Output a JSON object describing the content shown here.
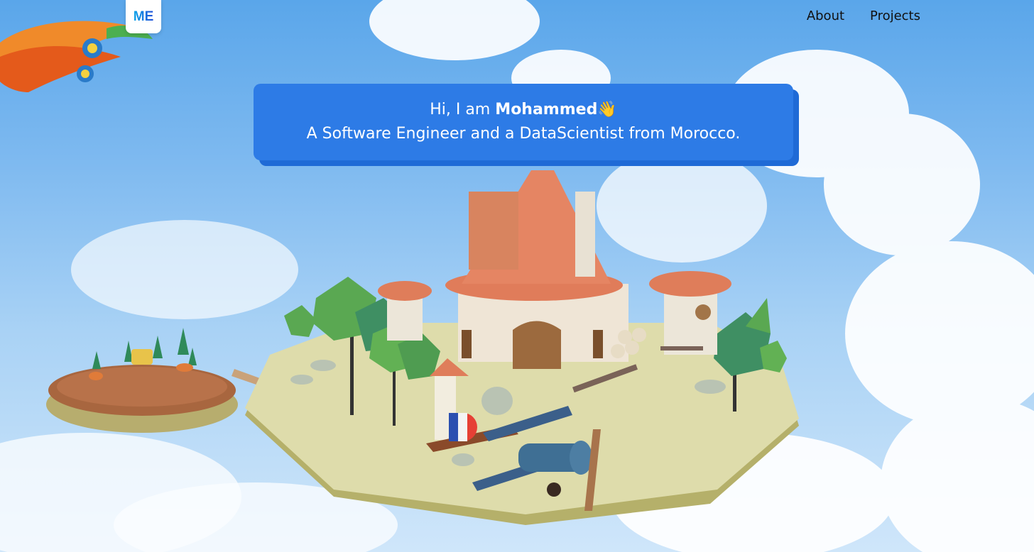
{
  "header": {
    "logo_text": "ME",
    "nav": [
      {
        "label": "About"
      },
      {
        "label": "Projects"
      }
    ]
  },
  "intro": {
    "greeting_prefix": "Hi, I am ",
    "name": "Mohammed",
    "wave": "👋",
    "tagline": "A Software Engineer and a DataScientist from Morocco."
  },
  "colors": {
    "accent": "#2d7be6",
    "accent_shadow": "#1f6ad6",
    "sky_top": "#5aa6ea",
    "sky_bottom": "#cfe6fa"
  }
}
